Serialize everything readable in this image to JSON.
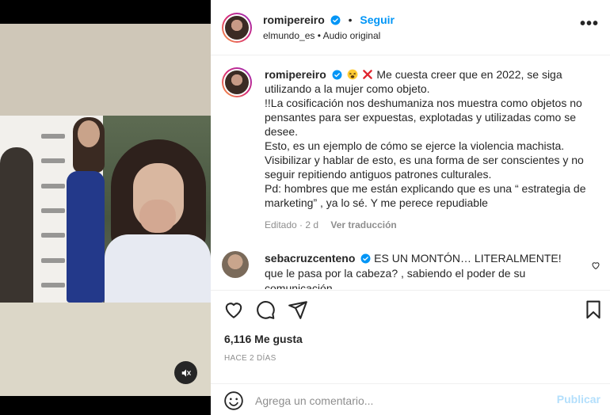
{
  "post": {
    "username": "romipereiro",
    "follow_label": "Seguir",
    "dot": "•",
    "audio_account": "elmundo_es",
    "audio_sep": " • ",
    "audio_label": "Audio original",
    "more_label": "•••"
  },
  "caption": {
    "username": "romipereiro",
    "lines": [
      "Me cuesta creer que en 2022, se siga utilizando a la mujer como objeto.",
      "!!La cosificación nos deshumaniza nos muestra como objetos no pensantes para ser expuestas, explotadas y utilizadas como se desee.",
      "Esto, es un ejemplo de cómo se ejerce la violencia machista.",
      "Visibilizar y hablar de esto, es una forma de ser conscientes y no seguir repitiendo antiguos patrones culturales.",
      "Pd: hombres que me están explicando que es una “ estrategia de marketing” , ya lo sé. Y me perece repudiable"
    ],
    "edited": "Editado · 2 d",
    "translate": "Ver traducción"
  },
  "comment": {
    "username": "sebacruzcenteno",
    "text": "ES UN MONTÓN… LITERALMENTE! que le pasa por la cabeza? , sabiendo el poder de su comunicación,"
  },
  "stats": {
    "likes": "6,116 Me gusta",
    "time": "HACE 2 DÍAS"
  },
  "composer": {
    "placeholder": "Agrega un comentario...",
    "post_label": "Publicar"
  },
  "colors": {
    "accent": "#0095f6",
    "verified": "#0095f6",
    "muted": "#8e8e8e",
    "post_disabled": "#b3dffc"
  }
}
